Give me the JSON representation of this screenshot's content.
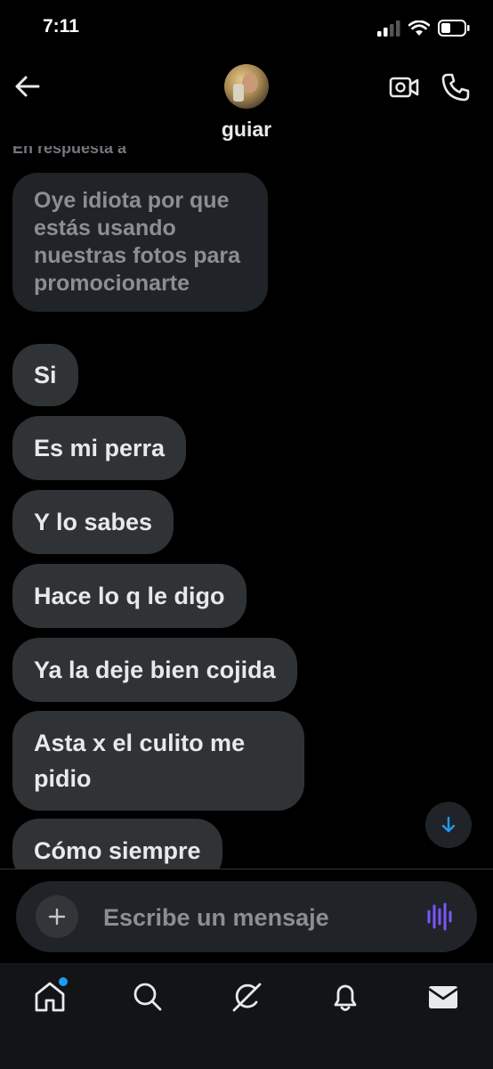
{
  "status_bar": {
    "time": "7:11"
  },
  "header": {
    "contact_name": "guiar"
  },
  "conversation": {
    "reply_indicator": "En respuesta a",
    "quoted_message": "Oye idiota por que estás usando nuestras fotos para promocionarte",
    "messages": [
      "Si",
      "Es mi perra",
      "Y lo sabes",
      "Hace lo q le digo",
      "Ya la deje bien cojida",
      "Asta x el culito me pidio",
      "Cómo siempre"
    ]
  },
  "composer": {
    "placeholder": "Escribe un mensaje"
  },
  "colors": {
    "background": "#000000",
    "bubble": "#2f3336",
    "accent_blue": "#1d9bf0",
    "voice_purple": "#7856ff"
  },
  "icons": {
    "header": [
      "back-arrow-icon",
      "video-camera-icon",
      "phone-icon"
    ],
    "composer": [
      "plus-icon",
      "voice-waveform-icon"
    ],
    "nav": [
      "home-icon",
      "search-icon",
      "grok-icon",
      "bell-icon",
      "mail-icon"
    ]
  }
}
